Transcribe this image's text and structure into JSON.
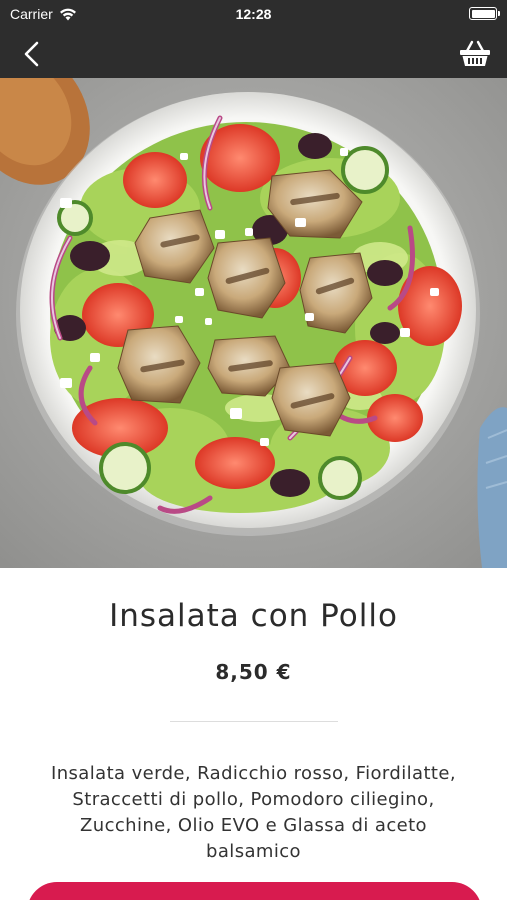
{
  "status_bar": {
    "carrier": "Carrier",
    "time": "12:28",
    "wifi_icon": "wifi-icon",
    "battery_icon": "battery-full-icon"
  },
  "nav": {
    "back_icon": "chevron-left-icon",
    "cart_icon": "basket-icon",
    "background": "#2d2d2d"
  },
  "product": {
    "image_icon": "salad-photo",
    "title": "Insalata con Pollo",
    "price": "8,50 €",
    "description": "Insalata verde, Radicchio rosso, Fiordilatte, Straccetti di pollo, Pomodoro ciliegino, Zucchine, Olio EVO e Glassa di aceto balsamico"
  },
  "colors": {
    "accent": "#d81b4f",
    "text": "#2b2b2b"
  }
}
